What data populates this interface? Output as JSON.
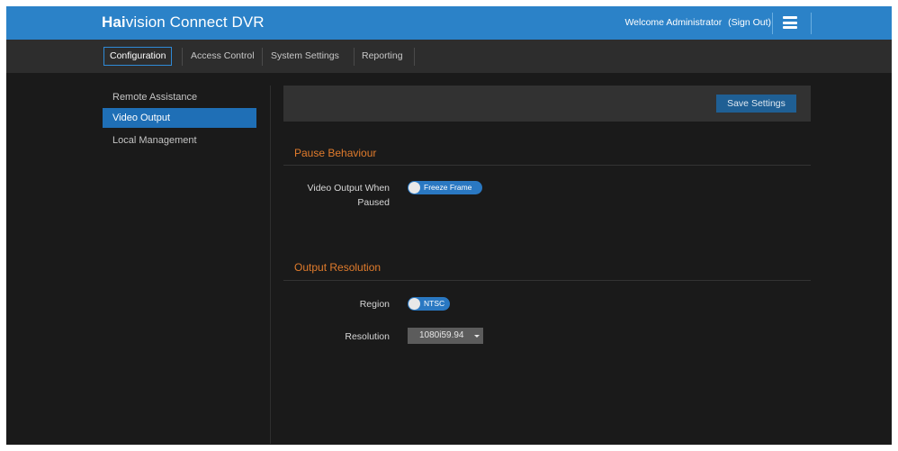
{
  "app": {
    "brand_bold": "Hai",
    "brand_rest": "vision Connect DVR",
    "welcome": "Welcome Administrator",
    "sign_out": "(Sign Out)",
    "menu_icon": "hamburger-menu-icon",
    "colors": {
      "topbar": "#2b82c8",
      "accent": "#1f6fb6",
      "section_title": "#e07b2c",
      "background": "#1a1a1a"
    }
  },
  "nav": {
    "tabs": [
      {
        "label": "Configuration",
        "active": true
      },
      {
        "label": "Access Control",
        "active": false
      },
      {
        "label": "System Settings",
        "active": false
      },
      {
        "label": "Reporting",
        "active": false
      }
    ]
  },
  "sidebar": {
    "items": [
      {
        "label": "Remote Assistance",
        "selected": false
      },
      {
        "label": "Video Output",
        "selected": true
      },
      {
        "label": "Local Management",
        "selected": false
      }
    ]
  },
  "toolbar": {
    "save_label": "Save Settings"
  },
  "pause": {
    "title": "Pause Behaviour",
    "video_output_label": "Video Output When Paused",
    "video_output_value": "Freeze Frame"
  },
  "output": {
    "title": "Output Resolution",
    "region_label": "Region",
    "region_value": "NTSC",
    "resolution_label": "Resolution",
    "resolution_value": "1080i59.94"
  }
}
